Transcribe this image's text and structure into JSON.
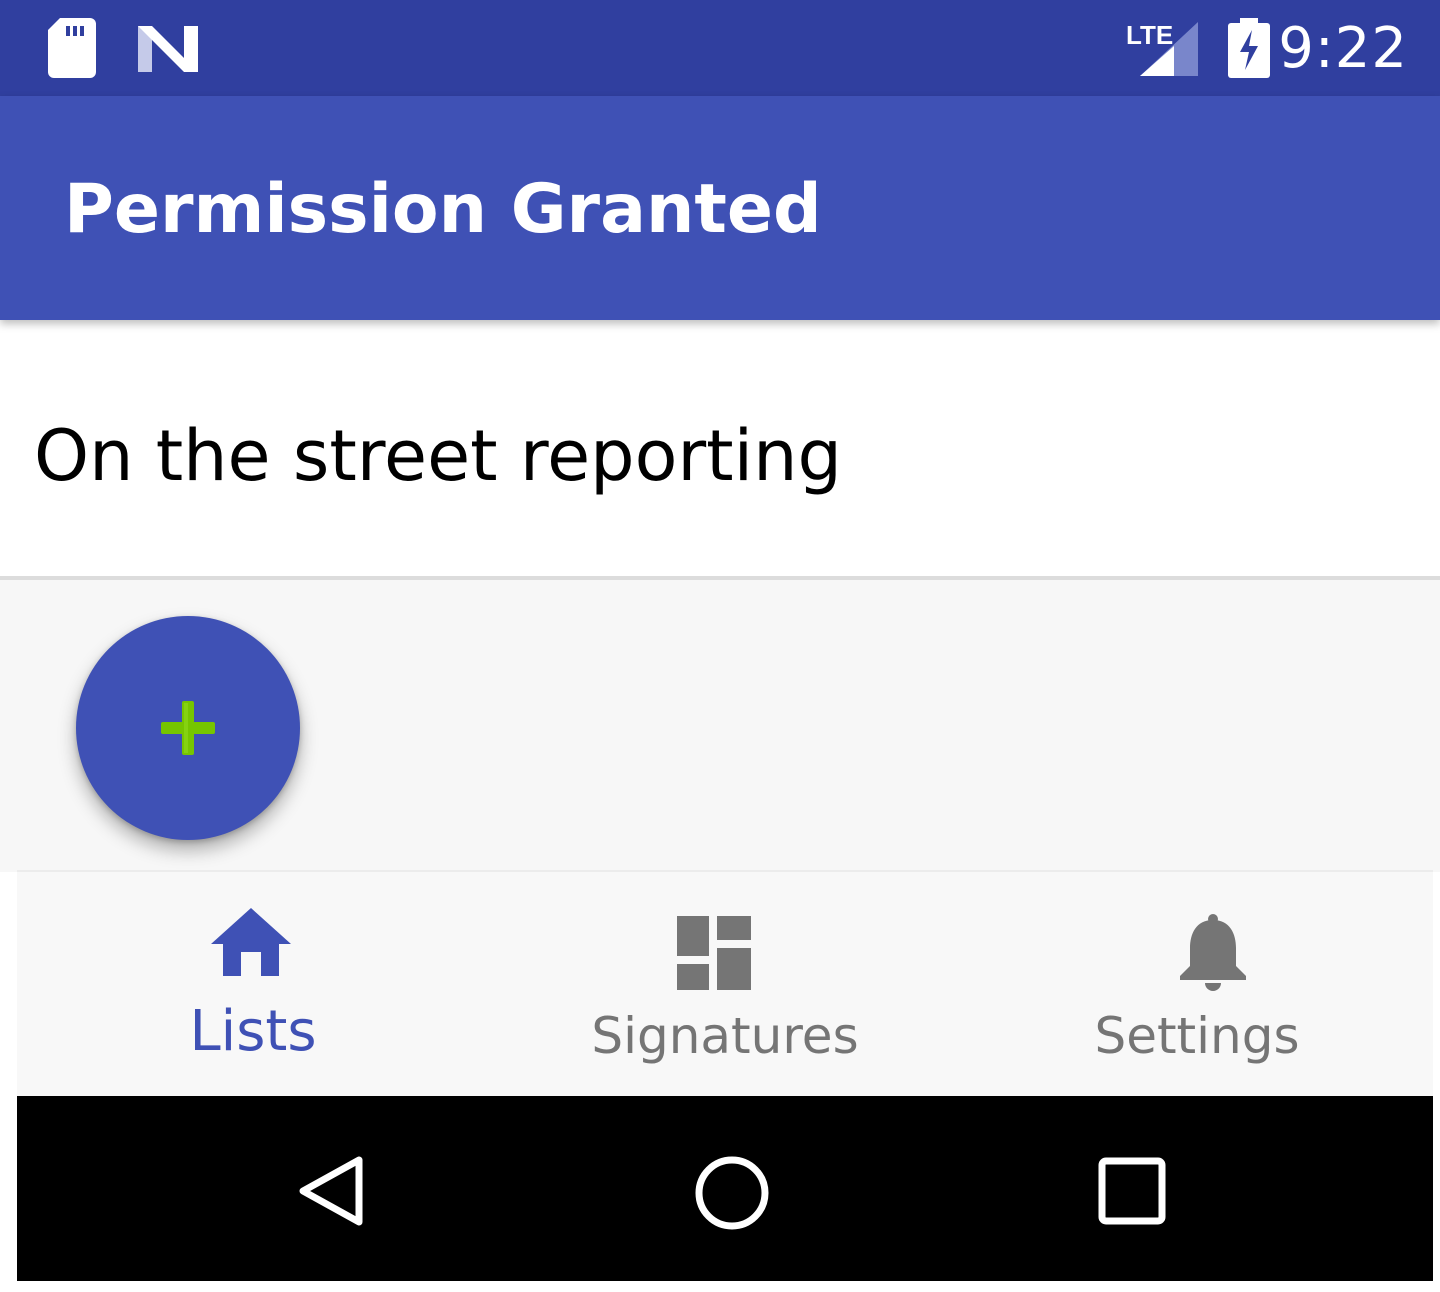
{
  "status_bar": {
    "time": "9:22",
    "network": "LTE",
    "icons": [
      "sd-card-icon",
      "android-n-icon",
      "lte-signal-icon",
      "battery-charging-icon"
    ]
  },
  "app_bar": {
    "title": "Permission Granted"
  },
  "list": {
    "items": [
      {
        "label": "On the street reporting"
      }
    ]
  },
  "fab": {
    "icon": "plus-icon",
    "colors": {
      "background": "#3F51B5",
      "icon": "#76C500"
    }
  },
  "bottom_nav": {
    "items": [
      {
        "label": "Lists",
        "icon": "home-icon",
        "active": true
      },
      {
        "label": "Signatures",
        "icon": "dashboard-icon",
        "active": false
      },
      {
        "label": "Settings",
        "icon": "bell-icon",
        "active": false
      }
    ]
  },
  "system_nav": {
    "buttons": [
      "back-icon",
      "home-circle-icon",
      "recents-icon"
    ]
  },
  "colors": {
    "primary": "#3F51B5",
    "primary_dark": "#303F9F",
    "inactive": "#757575",
    "accent_plus": "#76C500"
  }
}
